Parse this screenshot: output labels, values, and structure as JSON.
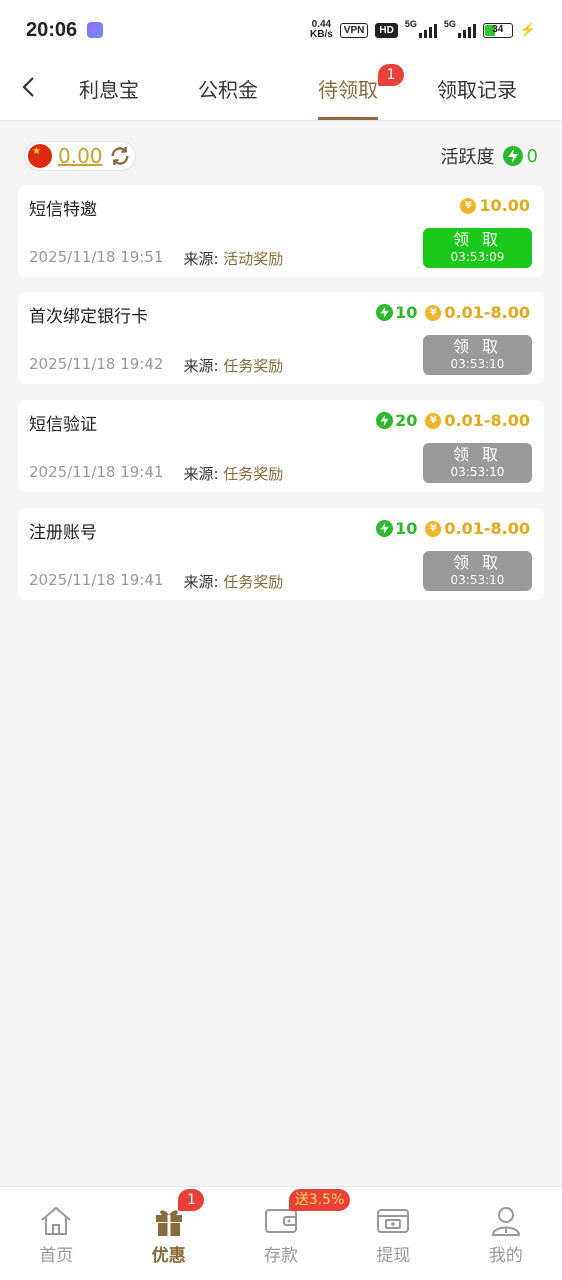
{
  "status_bar": {
    "time": "20:06",
    "net_speed_value": "0.44",
    "net_speed_unit": "KB/s",
    "vpn": "VPN",
    "hd": "HD",
    "sim1": "5G",
    "sim2": "5G",
    "battery": "34"
  },
  "nav": {
    "tabs": [
      {
        "label": "利息宝"
      },
      {
        "label": "公积金"
      },
      {
        "label": "待领取",
        "badge": "1",
        "active": true
      },
      {
        "label": "领取记录"
      }
    ]
  },
  "balance": {
    "value": "0.00",
    "activity_label": "活跃度",
    "activity_value": "0"
  },
  "cards": [
    {
      "title": "短信特邀",
      "energy": "",
      "coin": "10.00",
      "time": "2025/11/18 19:51",
      "source_label": "来源:",
      "source_value": "活动奖励",
      "button_label": "领 取",
      "timer": "03:53:09",
      "button_active": true
    },
    {
      "title": "首次绑定银行卡",
      "energy": "10",
      "coin": "0.01-8.00",
      "time": "2025/11/18 19:42",
      "source_label": "来源:",
      "source_value": "任务奖励",
      "button_label": "领 取",
      "timer": "03:53:10",
      "button_active": false
    },
    {
      "title": "短信验证",
      "energy": "20",
      "coin": "0.01-8.00",
      "time": "2025/11/18 19:41",
      "source_label": "来源:",
      "source_value": "任务奖励",
      "button_label": "领 取",
      "timer": "03:53:10",
      "button_active": false
    },
    {
      "title": "注册账号",
      "energy": "10",
      "coin": "0.01-8.00",
      "time": "2025/11/18 19:41",
      "source_label": "来源:",
      "source_value": "任务奖励",
      "button_label": "领 取",
      "timer": "03:53:10",
      "button_active": false
    }
  ],
  "coin_symbol": "¥",
  "bottom_nav": [
    {
      "label": "首页",
      "icon": "home-icon"
    },
    {
      "label": "优惠",
      "icon": "gift-icon",
      "badge": "1",
      "active": true
    },
    {
      "label": "存款",
      "icon": "wallet-icon",
      "badge": "送3.5%"
    },
    {
      "label": "提现",
      "icon": "withdraw-icon"
    },
    {
      "label": "我的",
      "icon": "profile-icon"
    }
  ],
  "colors": {
    "accent": "#8a6a3a",
    "claim_active": "#19c819",
    "claim_disabled": "#9a9a9a",
    "coin": "#e2a91a",
    "energy": "#2eb82e",
    "badge": "#e8413a"
  }
}
